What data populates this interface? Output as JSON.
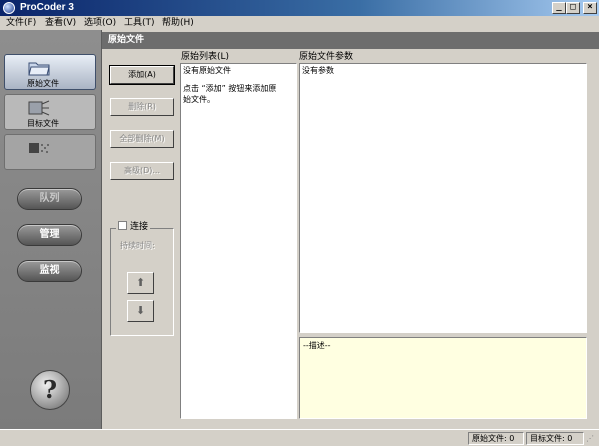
{
  "window": {
    "title": "ProCoder 3",
    "controls": {
      "minimize": "_",
      "maximize": "□",
      "close": "×"
    }
  },
  "menu": [
    {
      "label": "文件(F)"
    },
    {
      "label": "查看(V)"
    },
    {
      "label": "选项(O)"
    },
    {
      "label": "工具(T)"
    },
    {
      "label": "帮助(H)"
    }
  ],
  "sidebar": {
    "tabs": [
      {
        "label": "原始文件",
        "icon": "folder-icon",
        "state": "active"
      },
      {
        "label": "目标文件",
        "icon": "target-files-icon",
        "state": "normal"
      },
      {
        "label": "",
        "icon": "convert-icon",
        "state": "disabled"
      }
    ],
    "pills": [
      {
        "label": "队列",
        "state": "disabled"
      },
      {
        "label": "管理",
        "state": "normal"
      },
      {
        "label": "监视",
        "state": "normal"
      }
    ],
    "help_label": "?"
  },
  "section": {
    "title": "原始文件"
  },
  "actions": {
    "add": "添加(A)",
    "delete": "删除(R)",
    "delete_all": "全部删除(M)",
    "advanced": "高级(D)..."
  },
  "connection": {
    "checkbox_label": "连接",
    "duration_label": "持续时间:",
    "up_arrow": "⬆",
    "down_arrow": "⬇"
  },
  "source_list": {
    "label": "原始列表(L)",
    "empty_text": "没有原始文件",
    "hint_line1": "点击 “添加” 按钮来添加原",
    "hint_line2": "始文件。"
  },
  "params": {
    "label": "原始文件参数",
    "empty_text": "没有参数"
  },
  "description": {
    "label": "--描述--"
  },
  "statusbar": {
    "source_count": "原始文件: 0",
    "target_count": "目标文件: 0"
  },
  "colors": {
    "titlebar": "#0a246a",
    "panel": "#7b7b7b",
    "section_header": "#6d6d6d",
    "description_bg": "#ffffe1"
  }
}
